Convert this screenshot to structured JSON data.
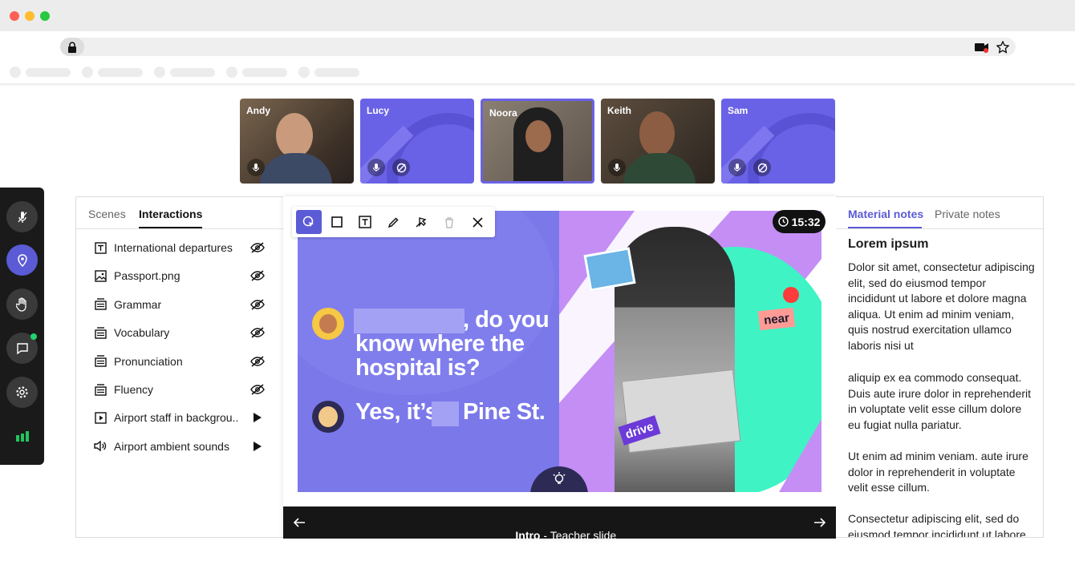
{
  "participants": [
    {
      "name": "Andy"
    },
    {
      "name": "Lucy"
    },
    {
      "name": "Noora"
    },
    {
      "name": "Keith"
    },
    {
      "name": "Sam"
    }
  ],
  "left_panel": {
    "tabs": [
      {
        "label": "Scenes"
      },
      {
        "label": "Interactions"
      }
    ],
    "items": [
      {
        "label": "International departures",
        "icon": "text-icon",
        "action_icon": "eye-off-icon"
      },
      {
        "label": "Passport.png",
        "icon": "image-icon",
        "action_icon": "eye-off-icon"
      },
      {
        "label": "Grammar",
        "icon": "slides-icon",
        "action_icon": "eye-off-icon"
      },
      {
        "label": "Vocabulary",
        "icon": "slides-icon",
        "action_icon": "eye-off-icon"
      },
      {
        "label": "Pronunciation",
        "icon": "slides-icon",
        "action_icon": "eye-off-icon"
      },
      {
        "label": "Fluency",
        "icon": "slides-icon",
        "action_icon": "eye-off-icon"
      },
      {
        "label": "Airport staff in backgrou..",
        "icon": "video-icon",
        "action_icon": "play-icon"
      },
      {
        "label": "Airport ambient sounds",
        "icon": "speaker-icon",
        "action_icon": "play-icon"
      }
    ]
  },
  "timer": {
    "value": "15:32"
  },
  "slide": {
    "question_suffix": ", do you",
    "question_line2": "know where the",
    "question_line3": "hospital is?",
    "answer_prefix": "Yes, it’s",
    "answer_suffix": "Pine St.",
    "sticker_near": "near",
    "sticker_drive": "drive"
  },
  "footer": {
    "title": "Intro",
    "separator": " - ",
    "subtitle": "Teacher slide"
  },
  "right_panel": {
    "tabs": [
      {
        "label": "Material notes"
      },
      {
        "label": "Private notes"
      }
    ],
    "title": "Lorem ipsum",
    "paragraphs": [
      "Dolor sit amet, consectetur adipiscing elit, sed do eiusmod tempor incididunt ut labore et dolore magna aliqua. Ut enim ad minim veniam, quis nostrud exercitation ullamco laboris nisi ut",
      "aliquip ex ea commodo consequat. Duis aute irure dolor in reprehenderit in voluptate velit esse cillum dolore eu fugiat nulla pariatur.",
      "Ut enim ad minim veniam. aute irure dolor in reprehenderit in voluptate velit esse cillum.",
      "Consectetur adipiscing elit, sed do eiusmod tempor incididunt ut labore"
    ]
  },
  "colors": {
    "accent": "#5b5bd6",
    "slide_purple": "#7b78ea",
    "mint": "#3ff3c5",
    "lilac": "#c48ef5"
  }
}
